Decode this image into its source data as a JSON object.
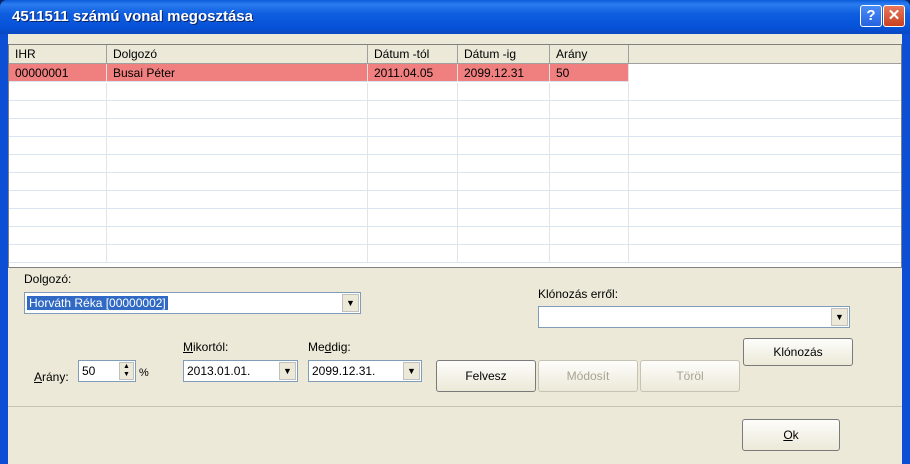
{
  "window": {
    "title": "4511511 számú vonal megosztása",
    "help": "?",
    "close": "✕"
  },
  "grid": {
    "columns": [
      "IHR",
      "Dolgozó",
      "Dátum -tól",
      "Dátum -ig",
      "Arány",
      ""
    ],
    "rows": [
      [
        "00000001",
        "Busai Péter",
        "2011.04.05",
        "2099.12.31",
        "50",
        ""
      ]
    ]
  },
  "form": {
    "dolgozo_label": "Dolgozó:",
    "dolgozo_value": "Horváth Réka [00000002]",
    "klonozas_label": "Klónozás erről:",
    "klonozas_value": "",
    "klonozas_button": "Klónozás",
    "arany_label_u": "A",
    "arany_label_rest": "rány:",
    "arany_value": "50",
    "percent": "%",
    "mikortol_label_u": "M",
    "mikortol_label_rest": "ikortól:",
    "mikortol_value": "2013.01.01.",
    "meddig_label_pre": "Me",
    "meddig_label_u": "d",
    "meddig_label_rest": "dig:",
    "meddig_value": "2099.12.31.",
    "felvesz": "Felvesz",
    "modosit": "Módosít",
    "torol": "Töröl",
    "ok_u": "O",
    "ok_rest": "k"
  }
}
